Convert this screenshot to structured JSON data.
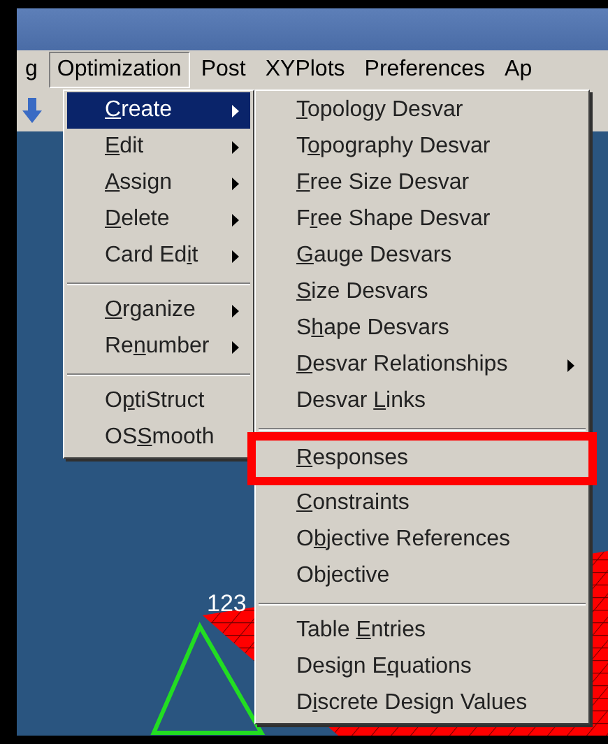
{
  "menubar": [
    {
      "label": "g",
      "selected": false
    },
    {
      "label": "Optimization",
      "selected": true
    },
    {
      "label": "Post",
      "selected": false
    },
    {
      "label": "XYPlots",
      "selected": false
    },
    {
      "label": "Preferences",
      "selected": false
    },
    {
      "label": "Ap",
      "selected": false
    }
  ],
  "viewport": {
    "node_label": "123"
  },
  "menu": [
    {
      "kind": "item",
      "key": "C",
      "post": "reate",
      "submenu": true,
      "selected": true
    },
    {
      "kind": "item",
      "key": "E",
      "post": "dit",
      "submenu": true,
      "selected": false
    },
    {
      "kind": "item",
      "key": "A",
      "post": "ssign",
      "submenu": true,
      "selected": false
    },
    {
      "kind": "item",
      "key": "D",
      "post": "elete",
      "submenu": true,
      "selected": false
    },
    {
      "kind": "item",
      "pre": "Card Ed",
      "key": "i",
      "post": "t",
      "submenu": true,
      "selected": false
    },
    {
      "kind": "separator"
    },
    {
      "kind": "item",
      "key": "O",
      "post": "rganize",
      "submenu": true,
      "selected": false
    },
    {
      "kind": "item",
      "pre": "Re",
      "key": "n",
      "post": "umber",
      "submenu": true,
      "selected": false
    },
    {
      "kind": "separator"
    },
    {
      "kind": "item",
      "pre": "O",
      "key": "p",
      "post": "tiStruct",
      "submenu": false,
      "selected": false
    },
    {
      "kind": "item",
      "pre": "OS",
      "key": "S",
      "post": "mooth",
      "submenu": false,
      "selected": false
    }
  ],
  "submenu": [
    {
      "kind": "item",
      "key": "T",
      "post": "opology Desvar",
      "submenu": false,
      "annotated": false
    },
    {
      "kind": "item",
      "pre": "T",
      "key": "o",
      "post": "pography Desvar",
      "submenu": false,
      "annotated": false
    },
    {
      "kind": "item",
      "key": "F",
      "post": "ree Size Desvar",
      "submenu": false,
      "annotated": false
    },
    {
      "kind": "item",
      "pre": "F",
      "key": "r",
      "post": "ee Shape Desvar",
      "submenu": false,
      "annotated": false
    },
    {
      "kind": "item",
      "key": "G",
      "post": "auge Desvars",
      "submenu": false,
      "annotated": false
    },
    {
      "kind": "item",
      "key": "S",
      "post": "ize Desvars",
      "submenu": false,
      "annotated": false
    },
    {
      "kind": "item",
      "pre": "S",
      "key": "h",
      "post": "ape Desvars",
      "submenu": false,
      "annotated": false
    },
    {
      "kind": "item",
      "key": "D",
      "post": "esvar Relationships",
      "submenu": true,
      "annotated": false
    },
    {
      "kind": "item",
      "pre": "Desvar ",
      "key": "L",
      "post": "inks",
      "submenu": false,
      "annotated": false
    },
    {
      "kind": "separator"
    },
    {
      "kind": "item",
      "key": "R",
      "post": "esponses",
      "submenu": false,
      "annotated": true
    },
    {
      "kind": "item",
      "key": "C",
      "post": "onstraints",
      "submenu": false,
      "annotated": false
    },
    {
      "kind": "item",
      "pre": "O",
      "key": "b",
      "post": "jective References",
      "submenu": false,
      "annotated": false
    },
    {
      "kind": "item",
      "pre": "Objective",
      "submenu": false,
      "annotated": false
    },
    {
      "kind": "separator"
    },
    {
      "kind": "item",
      "pre": "Table ",
      "key": "E",
      "post": "ntries",
      "submenu": false,
      "annotated": false
    },
    {
      "kind": "item",
      "pre": "Design E",
      "key": "q",
      "post": "uations",
      "submenu": false,
      "annotated": false
    },
    {
      "kind": "item",
      "pre": "D",
      "key": "i",
      "post": "screte Design Values",
      "submenu": false,
      "annotated": false
    }
  ]
}
